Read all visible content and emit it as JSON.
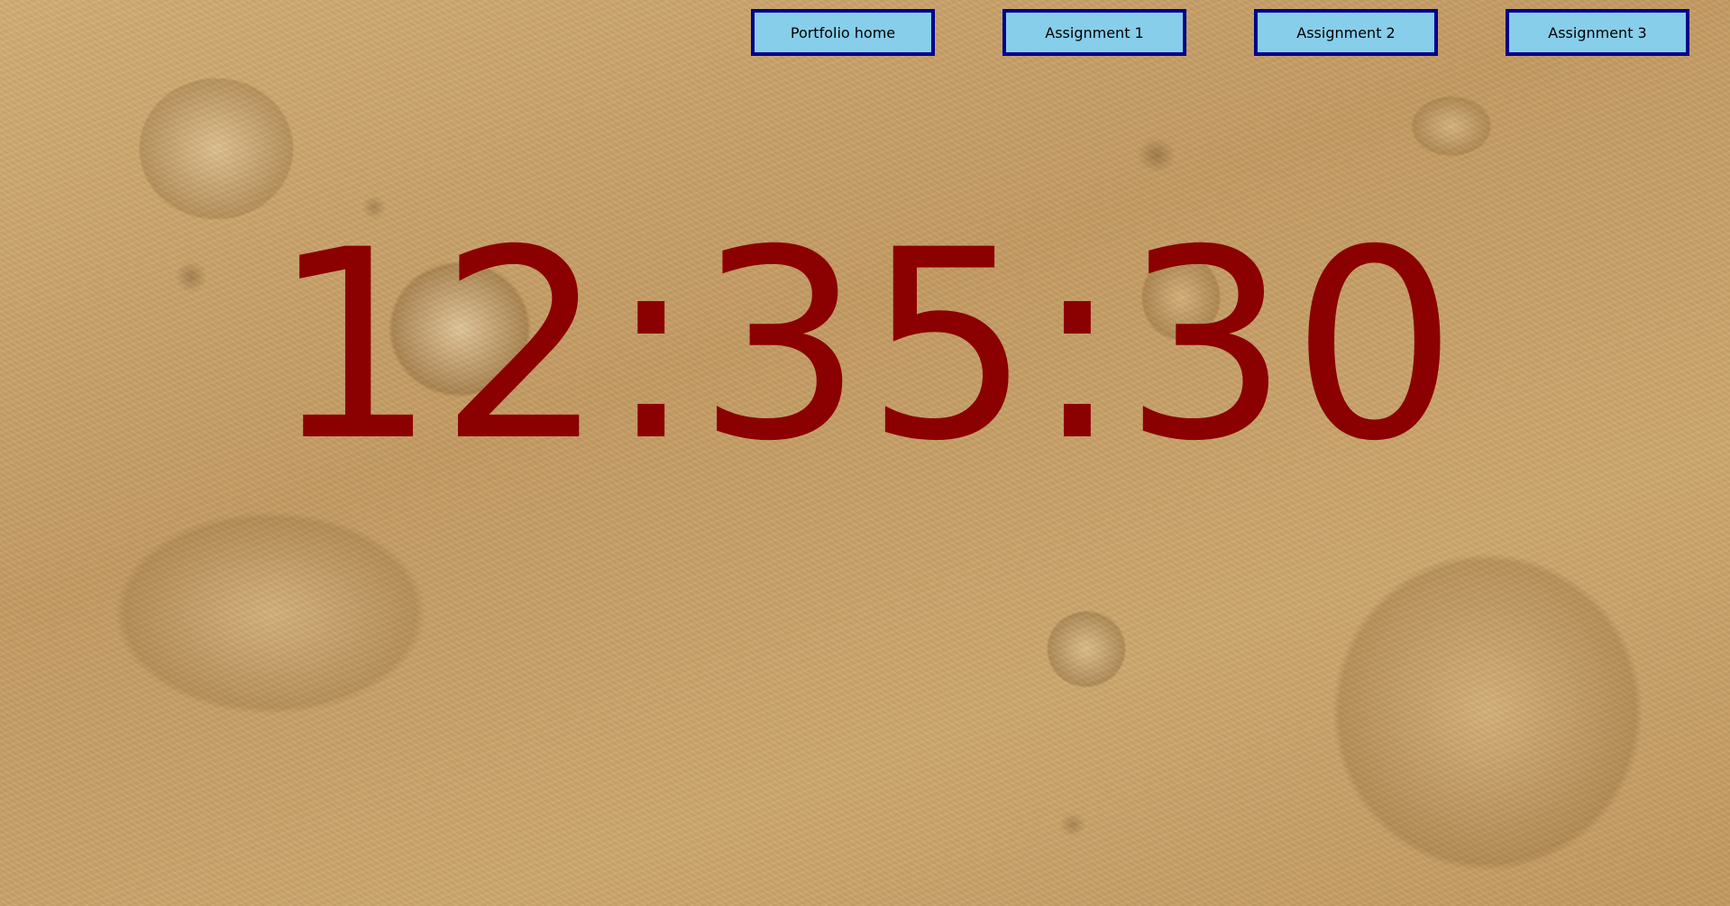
{
  "nav": {
    "items": [
      {
        "label": "Portfolio home"
      },
      {
        "label": "Assignment 1"
      },
      {
        "label": "Assignment 2"
      },
      {
        "label": "Assignment 3"
      }
    ]
  },
  "clock": {
    "time": "12:35:30",
    "color": "#8b0000"
  },
  "theme": {
    "button_bg": "#87ceeb",
    "button_border": "#00008b",
    "background": "mars-surface"
  }
}
